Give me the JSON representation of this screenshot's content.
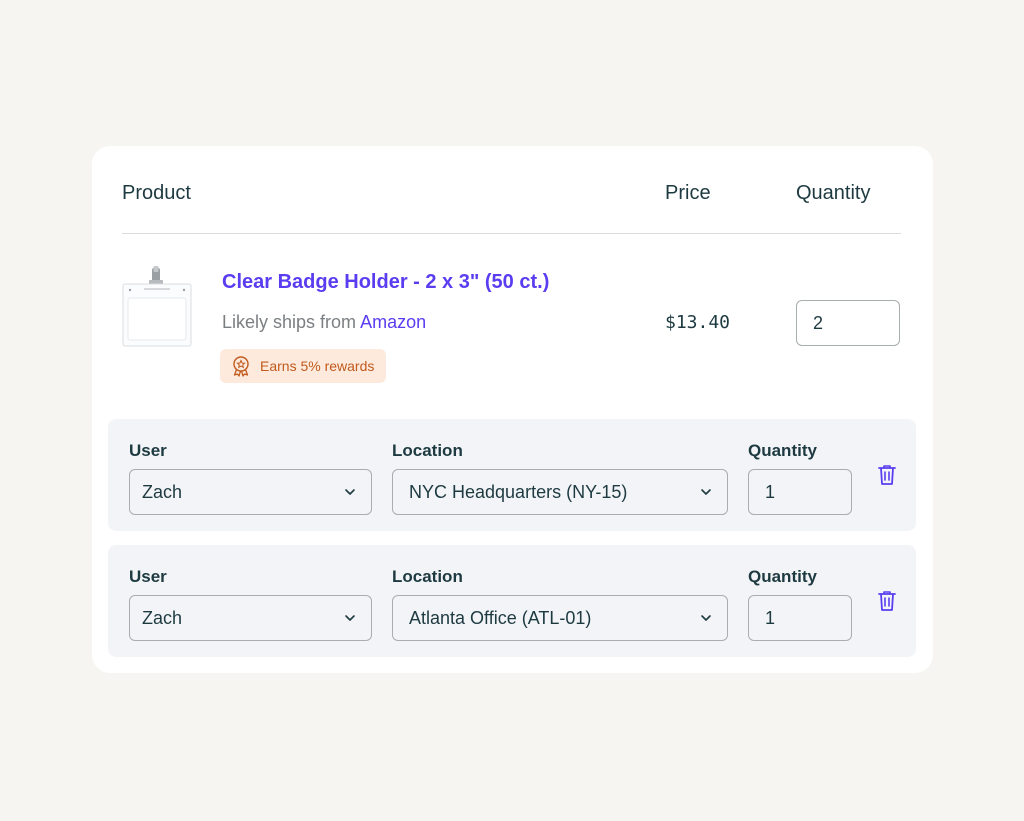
{
  "table": {
    "headers": {
      "product": "Product",
      "price": "Price",
      "quantity": "Quantity"
    }
  },
  "product": {
    "title": "Clear Badge Holder - 2 x 3\" (50 ct.)",
    "ships_prefix": "Likely ships from ",
    "ships_vendor": "Amazon",
    "rewards_badge": "Earns 5% rewards",
    "price": "$13.40",
    "quantity": "2",
    "thumbnail_icon": "badge-holder-image",
    "rewards_icon": "award-ribbon-icon"
  },
  "allocations": [
    {
      "user_label": "User",
      "user_value": "Zach",
      "location_label": "Location",
      "location_value": "NYC Headquarters (NY-15)",
      "quantity_label": "Quantity",
      "quantity_value": "1"
    },
    {
      "user_label": "User",
      "user_value": "Zach",
      "location_label": "Location",
      "location_value": "Atlanta Office (ATL-01)",
      "quantity_label": "Quantity",
      "quantity_value": "1"
    }
  ],
  "colors": {
    "accent": "#5a3df0",
    "text": "#1d3a41",
    "rewards_bg": "#fdeadd",
    "rewards_text": "#c15a1d",
    "page_bg": "#f6f5f1"
  }
}
